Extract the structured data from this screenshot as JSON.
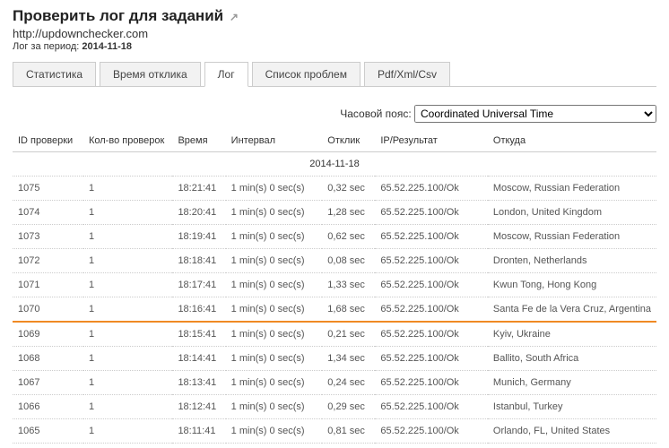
{
  "header": {
    "title": "Проверить лог для заданий",
    "url": "http://updownchecker.com",
    "period_label": "Лог за период:",
    "period_value": "2014-11-18"
  },
  "tabs": [
    {
      "label": "Статистика",
      "active": false
    },
    {
      "label": "Время отклика",
      "active": false
    },
    {
      "label": "Лог",
      "active": true
    },
    {
      "label": "Список проблем",
      "active": false
    },
    {
      "label": "Pdf/Xml/Csv",
      "active": false
    }
  ],
  "timezone": {
    "label": "Часовой пояс:",
    "value": "Coordinated Universal Time"
  },
  "columns": {
    "id": "ID проверки",
    "checks": "Кол-во проверок",
    "time": "Время",
    "interval": "Интервал",
    "response": "Отклик",
    "ip": "IP/Результат",
    "from": "Откуда"
  },
  "date_separator": "2014-11-18",
  "rows": [
    {
      "id": "1075",
      "checks": "1",
      "time": "18:21:41",
      "interval": "1 min(s) 0 sec(s)",
      "response": "0,32 sec",
      "ip": "65.52.225.100/Ok",
      "from": "Moscow, Russian Federation",
      "highlight": false
    },
    {
      "id": "1074",
      "checks": "1",
      "time": "18:20:41",
      "interval": "1 min(s) 0 sec(s)",
      "response": "1,28 sec",
      "ip": "65.52.225.100/Ok",
      "from": "London, United Kingdom",
      "highlight": false
    },
    {
      "id": "1073",
      "checks": "1",
      "time": "18:19:41",
      "interval": "1 min(s) 0 sec(s)",
      "response": "0,62 sec",
      "ip": "65.52.225.100/Ok",
      "from": "Moscow, Russian Federation",
      "highlight": false
    },
    {
      "id": "1072",
      "checks": "1",
      "time": "18:18:41",
      "interval": "1 min(s) 0 sec(s)",
      "response": "0,08 sec",
      "ip": "65.52.225.100/Ok",
      "from": "Dronten, Netherlands",
      "highlight": false
    },
    {
      "id": "1071",
      "checks": "1",
      "time": "18:17:41",
      "interval": "1 min(s) 0 sec(s)",
      "response": "1,33 sec",
      "ip": "65.52.225.100/Ok",
      "from": "Kwun Tong, Hong Kong",
      "highlight": false
    },
    {
      "id": "1070",
      "checks": "1",
      "time": "18:16:41",
      "interval": "1 min(s) 0 sec(s)",
      "response": "1,68 sec",
      "ip": "65.52.225.100/Ok",
      "from": "Santa Fe de la Vera Cruz, Argentina",
      "highlight": true
    },
    {
      "id": "1069",
      "checks": "1",
      "time": "18:15:41",
      "interval": "1 min(s) 0 sec(s)",
      "response": "0,21 sec",
      "ip": "65.52.225.100/Ok",
      "from": "Kyiv, Ukraine",
      "highlight": false
    },
    {
      "id": "1068",
      "checks": "1",
      "time": "18:14:41",
      "interval": "1 min(s) 0 sec(s)",
      "response": "1,34 sec",
      "ip": "65.52.225.100/Ok",
      "from": "Ballito, South Africa",
      "highlight": false
    },
    {
      "id": "1067",
      "checks": "1",
      "time": "18:13:41",
      "interval": "1 min(s) 0 sec(s)",
      "response": "0,24 sec",
      "ip": "65.52.225.100/Ok",
      "from": "Munich, Germany",
      "highlight": false
    },
    {
      "id": "1066",
      "checks": "1",
      "time": "18:12:41",
      "interval": "1 min(s) 0 sec(s)",
      "response": "0,29 sec",
      "ip": "65.52.225.100/Ok",
      "from": "Istanbul, Turkey",
      "highlight": false
    },
    {
      "id": "1065",
      "checks": "1",
      "time": "18:11:41",
      "interval": "1 min(s) 0 sec(s)",
      "response": "0,81 sec",
      "ip": "65.52.225.100/Ok",
      "from": "Orlando, FL, United States",
      "highlight": false
    }
  ]
}
